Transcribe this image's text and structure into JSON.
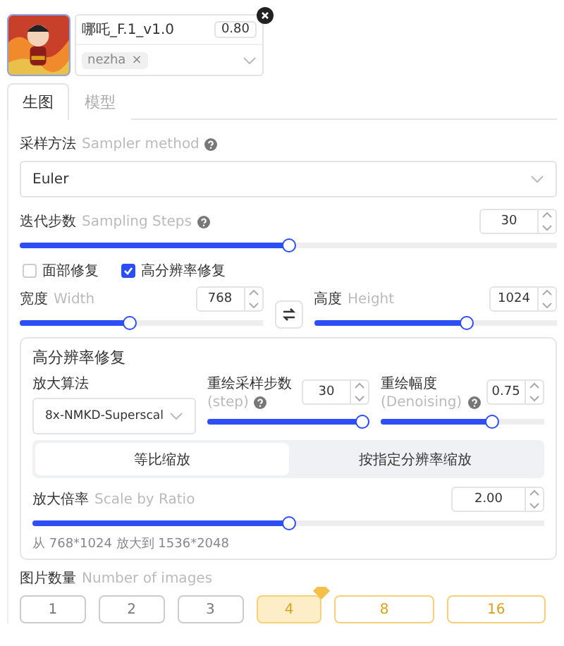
{
  "lora": {
    "name": "哪吒_F.1_v1.0",
    "weight": "0.80",
    "tags": [
      {
        "label": "nezha",
        "remove": "×"
      }
    ]
  },
  "tabs": [
    {
      "label": "生图",
      "selected": true
    },
    {
      "label": "模型",
      "selected": false
    }
  ],
  "sampler": {
    "label": "采样方法",
    "hint": "Sampler method",
    "value": "Euler"
  },
  "steps": {
    "label": "迭代步数",
    "hint": "Sampling Steps",
    "value": "30",
    "level": 0.5
  },
  "options": [
    {
      "label": "面部修复",
      "checked": false
    },
    {
      "label": "高分辨率修复",
      "checked": true
    }
  ],
  "size": [
    {
      "label": "宽度",
      "hint": "Width",
      "value": "768",
      "level": 0.45
    },
    {
      "label": "高度",
      "hint": "Height",
      "value": "1024",
      "level": 0.64
    }
  ],
  "hires": {
    "title": "高分辨率修复",
    "upscaler": {
      "label": "放大算法",
      "value": "8x-NMKD-Superscal"
    },
    "steps": {
      "label": "重绘采样步数",
      "hint": "(step)",
      "value": "30",
      "level": 1
    },
    "denoising": {
      "label": "重绘幅度",
      "hint": "(Denoising)",
      "value": "0.75",
      "level": 0.7
    },
    "modes": [
      {
        "label": "等比缩放",
        "selected": true
      },
      {
        "label": "按指定分辨率缩放",
        "selected": false
      }
    ],
    "scale": {
      "label": "放大倍率",
      "hint": "Scale by Ratio",
      "value": "2.00",
      "level": 0.5
    },
    "note": "从 768*1024 放大到 1536*2048"
  },
  "images": {
    "label": "图片数量",
    "hint": "Number of images",
    "counts": [
      {
        "label": "1",
        "kind": "normal",
        "selected": false,
        "vip": false
      },
      {
        "label": "2",
        "kind": "normal",
        "selected": false,
        "vip": false
      },
      {
        "label": "3",
        "kind": "normal",
        "selected": false,
        "vip": false
      },
      {
        "label": "4",
        "kind": "normal",
        "selected": true,
        "vip": true
      },
      {
        "label": "8",
        "kind": "premium",
        "selected": false,
        "vip": false
      },
      {
        "label": "16",
        "kind": "premium",
        "selected": false,
        "vip": false
      }
    ]
  }
}
